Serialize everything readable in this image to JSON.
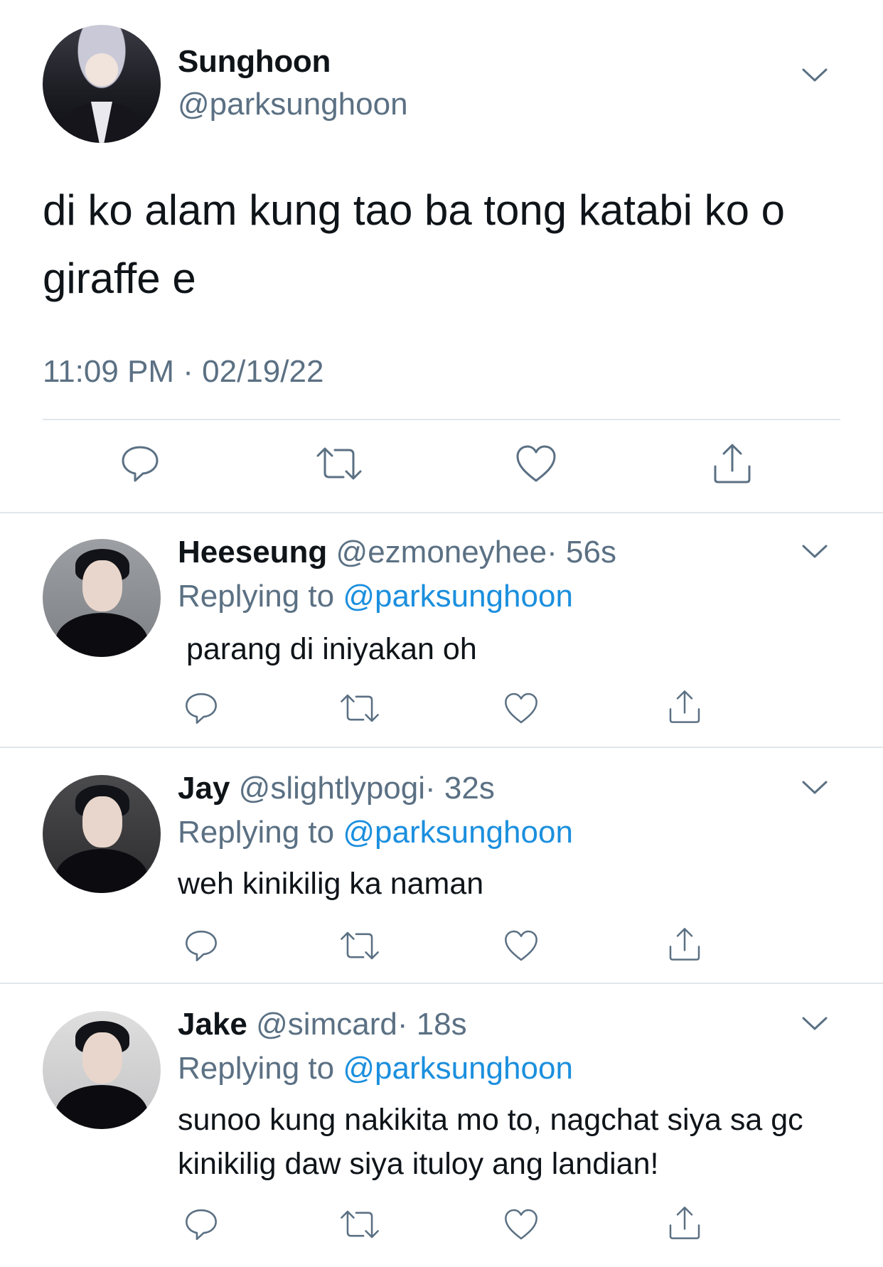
{
  "main_tweet": {
    "name": "Sunghoon",
    "handle": "@parksunghoon",
    "text": "di ko alam kung tao ba tong katabi ko o giraffe e",
    "timestamp": "11:09 PM · 02/19/22"
  },
  "replies": [
    {
      "name": "Heeseung",
      "handle": "@ezmoneyhee",
      "time": "· 56s",
      "replying_prefix": "Replying to ",
      "replying_to": "@parksunghoon",
      "text": " parang di iniyakan oh"
    },
    {
      "name": "Jay",
      "handle": "@slightlypogi",
      "time": "· 32s",
      "replying_prefix": "Replying to ",
      "replying_to": "@parksunghoon",
      "text": "weh kinikilig ka naman"
    },
    {
      "name": "Jake",
      "handle": "@simcard",
      "time": "· 18s",
      "replying_prefix": "Replying to ",
      "replying_to": "@parksunghoon",
      "text": "sunoo kung nakikita mo to, nagchat siya sa gc kinikilig daw siya ituloy ang landian!"
    }
  ],
  "icons": {
    "reply": "reply-icon",
    "retweet": "retweet-icon",
    "like": "heart-icon",
    "share": "share-icon",
    "menu": "chevron-down-icon"
  },
  "colors": {
    "text": "#0f1419",
    "secondary": "#5b7083",
    "mention": "#1b8fde",
    "divider": "#e1e6ea"
  }
}
